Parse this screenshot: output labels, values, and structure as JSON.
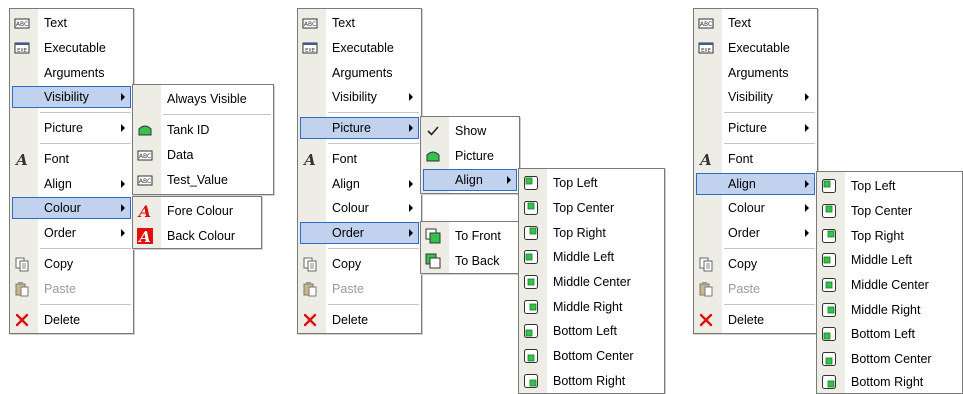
{
  "main_menu": {
    "text": "Text",
    "executable": "Executable",
    "arguments": "Arguments",
    "visibility": "Visibility",
    "picture": "Picture",
    "font": "Font",
    "align": "Align",
    "colour": "Colour",
    "order": "Order",
    "copy": "Copy",
    "paste": "Paste",
    "delete": "Delete"
  },
  "visibility_submenu": {
    "always_visible": "Always Visible",
    "tank_id": "Tank ID",
    "data": "Data",
    "test_value": "Test_Value"
  },
  "colour_submenu": {
    "fore_colour": "Fore Colour",
    "back_colour": "Back Colour"
  },
  "picture_submenu": {
    "show": "Show",
    "picture": "Picture",
    "align": "Align"
  },
  "order_submenu": {
    "to_front": "To Front",
    "to_back": "To Back"
  },
  "align_submenu": {
    "top_left": "Top Left",
    "top_center": "Top Center",
    "top_right": "Top Right",
    "middle_left": "Middle Left",
    "middle_center": "Middle Center",
    "middle_right": "Middle Right",
    "bottom_left": "Bottom Left",
    "bottom_center": "Bottom Center",
    "bottom_right": "Bottom Right"
  },
  "colors": {
    "highlight_bg": "#c1d2ee",
    "highlight_border": "#316ac5",
    "icon_gutter": "#eeede5",
    "icon_green": "#33c24a",
    "delete_red": "#e01010"
  }
}
